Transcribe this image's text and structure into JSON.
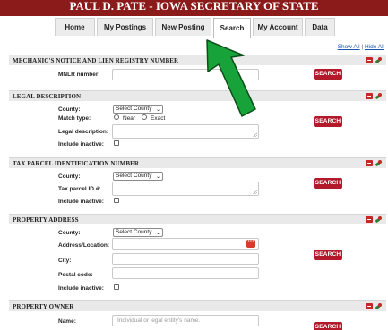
{
  "banner": {
    "title": "PAUL D. PATE - IOWA SECRETARY OF STATE"
  },
  "tabs": [
    {
      "label": "Home"
    },
    {
      "label": "My Postings"
    },
    {
      "label": "New Posting"
    },
    {
      "label": "Search",
      "active": true
    },
    {
      "label": "My Account"
    },
    {
      "label": "Data"
    }
  ],
  "show_hide": {
    "show_all": "Show All",
    "separator": "|",
    "hide_all": "Hide All"
  },
  "sections": {
    "mnlr": {
      "title": "MECHANIC'S NOTICE AND LIEN REGISTRY NUMBER",
      "mnlr_label": "MNLR number:",
      "search_label": "SEARCH"
    },
    "legal": {
      "title": "LEGAL DESCRIPTION",
      "county_label": "County:",
      "county_value": "Select County",
      "match_label": "Match type:",
      "match_near": "Near",
      "match_exact": "Exact",
      "desc_label": "Legal description:",
      "inactive_label": "Include inactive:",
      "search_label": "SEARCH"
    },
    "parcel": {
      "title": "TAX PARCEL IDENTIFICATION NUMBER",
      "county_label": "County:",
      "county_value": "Select County",
      "parcel_label": "Tax parcel ID #:",
      "inactive_label": "Include inactive:",
      "search_label": "SEARCH"
    },
    "address": {
      "title": "PROPERTY ADDRESS",
      "county_label": "County:",
      "county_value": "Select County",
      "address_label": "Address/Location:",
      "city_label": "City:",
      "postal_label": "Postal code:",
      "inactive_label": "Include inactive:",
      "search_label": "SEARCH",
      "lookup_glyph": "•••"
    },
    "owner": {
      "title": "PROPERTY OWNER",
      "name_label": "Name:",
      "name_placeholder": "Individual or legal entity's name.",
      "search_label": "SEARCH"
    }
  },
  "colors": {
    "banner": "#8b1a1a",
    "button": "#b3182b",
    "arrow": "#18a33a"
  },
  "icons": [
    "collapse-icon",
    "pin-icon",
    "chevron-down-icon",
    "lookup-dots-icon",
    "green-arrow-annotation"
  ]
}
